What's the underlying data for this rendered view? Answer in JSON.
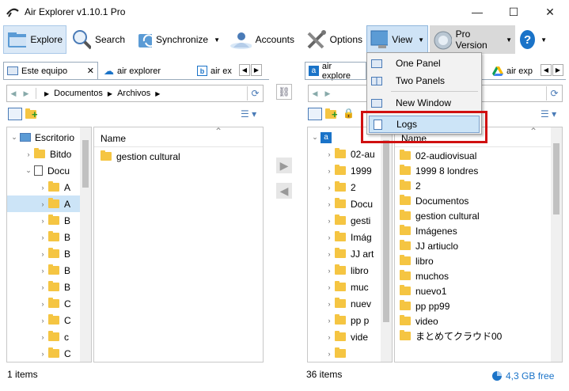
{
  "window": {
    "title": "Air Explorer v1.10.1 Pro",
    "min": "—",
    "max": "☐",
    "close": "✕"
  },
  "toolbar": {
    "explore": "Explore",
    "search": "Search",
    "synchronize": "Synchronize",
    "accounts": "Accounts",
    "options": "Options",
    "view": "View",
    "pro": "Pro Version",
    "help": "?"
  },
  "left": {
    "tabs": [
      {
        "label": "Este equipo"
      },
      {
        "label": "air explorer"
      },
      {
        "label": "air ex"
      }
    ],
    "breadcrumb": [
      "Documentos",
      "Archivos"
    ],
    "tree": [
      {
        "label": "Escritorio",
        "level": 0,
        "expanded": true
      },
      {
        "label": "Bitdo",
        "level": 1,
        "expanded": false
      },
      {
        "label": "Docu",
        "level": 1,
        "expanded": true
      },
      {
        "label": "A",
        "level": 2
      },
      {
        "label": "A",
        "level": 2,
        "selected": true
      },
      {
        "label": "B",
        "level": 2
      },
      {
        "label": "B",
        "level": 2
      },
      {
        "label": "B",
        "level": 2
      },
      {
        "label": "B",
        "level": 2
      },
      {
        "label": "B",
        "level": 2
      },
      {
        "label": "C",
        "level": 2
      },
      {
        "label": "C",
        "level": 2
      },
      {
        "label": "c",
        "level": 2
      },
      {
        "label": "C",
        "level": 2
      }
    ],
    "list_header": "Name",
    "files": [
      "gestion cultural"
    ],
    "status": "1 items"
  },
  "right": {
    "tabs": [
      {
        "label": "air explore"
      },
      {
        "label": "air exp"
      }
    ],
    "tree": [
      {
        "label": "02-au",
        "expanded": false
      },
      {
        "label": "1999",
        "expanded": false
      },
      {
        "label": "2",
        "expanded": false
      },
      {
        "label": "Docu",
        "expanded": false
      },
      {
        "label": "gesti",
        "expanded": false
      },
      {
        "label": "Imág",
        "expanded": false
      },
      {
        "label": "JJ art",
        "expanded": false
      },
      {
        "label": "libro",
        "expanded": false
      },
      {
        "label": "muc",
        "expanded": false
      },
      {
        "label": "nuev",
        "expanded": false
      },
      {
        "label": "pp p",
        "expanded": false
      },
      {
        "label": "vide",
        "expanded": false
      },
      {
        "label": "",
        "expanded": false
      }
    ],
    "list_header": "Name",
    "files": [
      "02-audiovisual",
      "1999 8 londres",
      "2",
      "Documentos",
      "gestion cultural",
      "Imágenes",
      "JJ artiuclo",
      "libro",
      "muchos",
      "nuevo1",
      "pp pp99",
      "video",
      "まとめてクラウド00"
    ],
    "status": "36 items",
    "free": "4,3 GB free"
  },
  "view_menu": {
    "items": [
      {
        "label": "One Panel"
      },
      {
        "label": "Two Panels"
      },
      {
        "label": "New Window"
      },
      {
        "label": "Logs"
      }
    ]
  },
  "colors": {
    "accent": "#1a73c8",
    "highlight": "#d01010",
    "menu_selected": "#cce4f7"
  }
}
